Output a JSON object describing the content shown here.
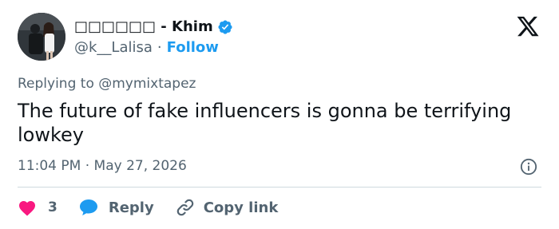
{
  "author": {
    "display_name": "□□□□□□ - Khim",
    "handle": "@k__Lalisa",
    "separator": "·",
    "follow_label": "Follow"
  },
  "reply_context": "Replying to @mymixtapez",
  "text": "The future of fake influencers is gonna be terrifying lowkey",
  "timestamp": "11:04 PM · May 27, 2026",
  "actions": {
    "like_count": "3",
    "reply_label": "Reply",
    "copy_label": "Copy link"
  },
  "icons": {
    "verified": "verified-badge-icon",
    "logo": "x-logo-icon",
    "info": "info-icon",
    "like": "heart-icon",
    "reply": "speech-bubble-icon",
    "copy": "link-icon"
  },
  "colors": {
    "accent": "#1d9bf0",
    "like": "#f91880",
    "text": "#0f1419",
    "secondary": "#536471",
    "divider": "#cfd9de"
  }
}
